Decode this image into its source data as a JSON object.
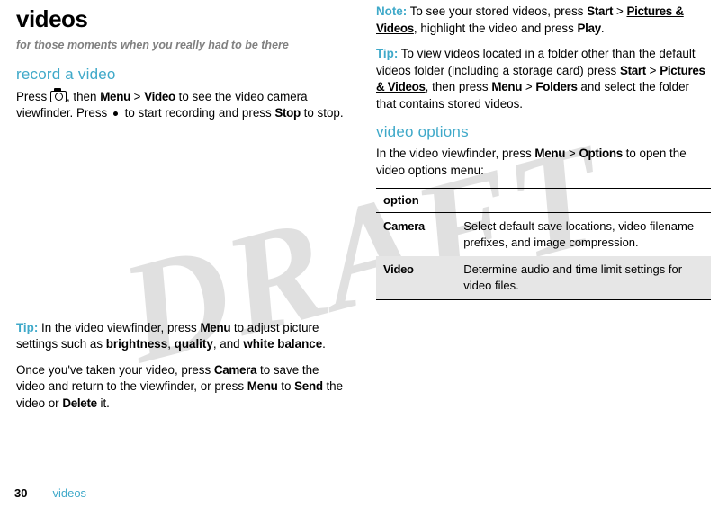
{
  "watermark": "DRAFT",
  "left": {
    "title": "videos",
    "subtitle": "for those moments when you really had to be there",
    "h2_record": "record a video",
    "p1_a": "Press ",
    "p1_b": ", then ",
    "p1_menu": "Menu",
    "p1_gt1": " > ",
    "p1_video": "Video",
    "p1_c": " to see the video camera viewfinder. Press ",
    "p1_d": " to start recording and press ",
    "p1_stop": "Stop",
    "p1_e": " to stop.",
    "tip_label": "Tip:",
    "tip_a": " In the video viewfinder, press ",
    "tip_menu": "Menu",
    "tip_b": " to adjust picture settings such as ",
    "tip_bright": "brightness",
    "tip_c": ", ",
    "tip_quality": "quality",
    "tip_d": ", and ",
    "tip_wb": "white balance",
    "tip_e": ".",
    "p2_a": "Once you've taken your video, press ",
    "p2_camera": "Camera",
    "p2_b": " to save the video and return to the viewfinder, or press ",
    "p2_menu": "Menu",
    "p2_c": " to ",
    "p2_send": "Send",
    "p2_d": " the video or ",
    "p2_delete": "Delete",
    "p2_e": " it."
  },
  "right": {
    "note_label": "Note:",
    "note_a": " To see your stored videos, press ",
    "note_start": "Start",
    "note_gt1": " > ",
    "note_pv": "Pictures & Videos",
    "note_b": ", highlight the video and press ",
    "note_play": "Play",
    "note_c": ".",
    "tip2_label": "Tip:",
    "tip2_a": " To view videos located in a folder other than the default videos folder (including a storage card) press ",
    "tip2_start": "Start",
    "tip2_gt1": " > ",
    "tip2_pv": "Pictures & Videos",
    "tip2_b": ", then press ",
    "tip2_menu": "Menu",
    "tip2_gt2": " > ",
    "tip2_folders": "Folders",
    "tip2_c": " and select the folder that contains stored videos.",
    "h2_options": "video options",
    "p_opts_a": "In the video viewfinder, press ",
    "p_opts_menu": "Menu",
    "p_opts_gt": " > ",
    "p_opts_options": "Options",
    "p_opts_b": " to open the video options menu:",
    "table": {
      "header": "option",
      "rows": [
        {
          "label": "Camera",
          "desc": "Select default save locations, video filename prefixes, and image compression."
        },
        {
          "label": "Video",
          "desc": "Determine audio and time limit settings for video files."
        }
      ]
    }
  },
  "footer": {
    "page": "30",
    "section": "videos"
  }
}
